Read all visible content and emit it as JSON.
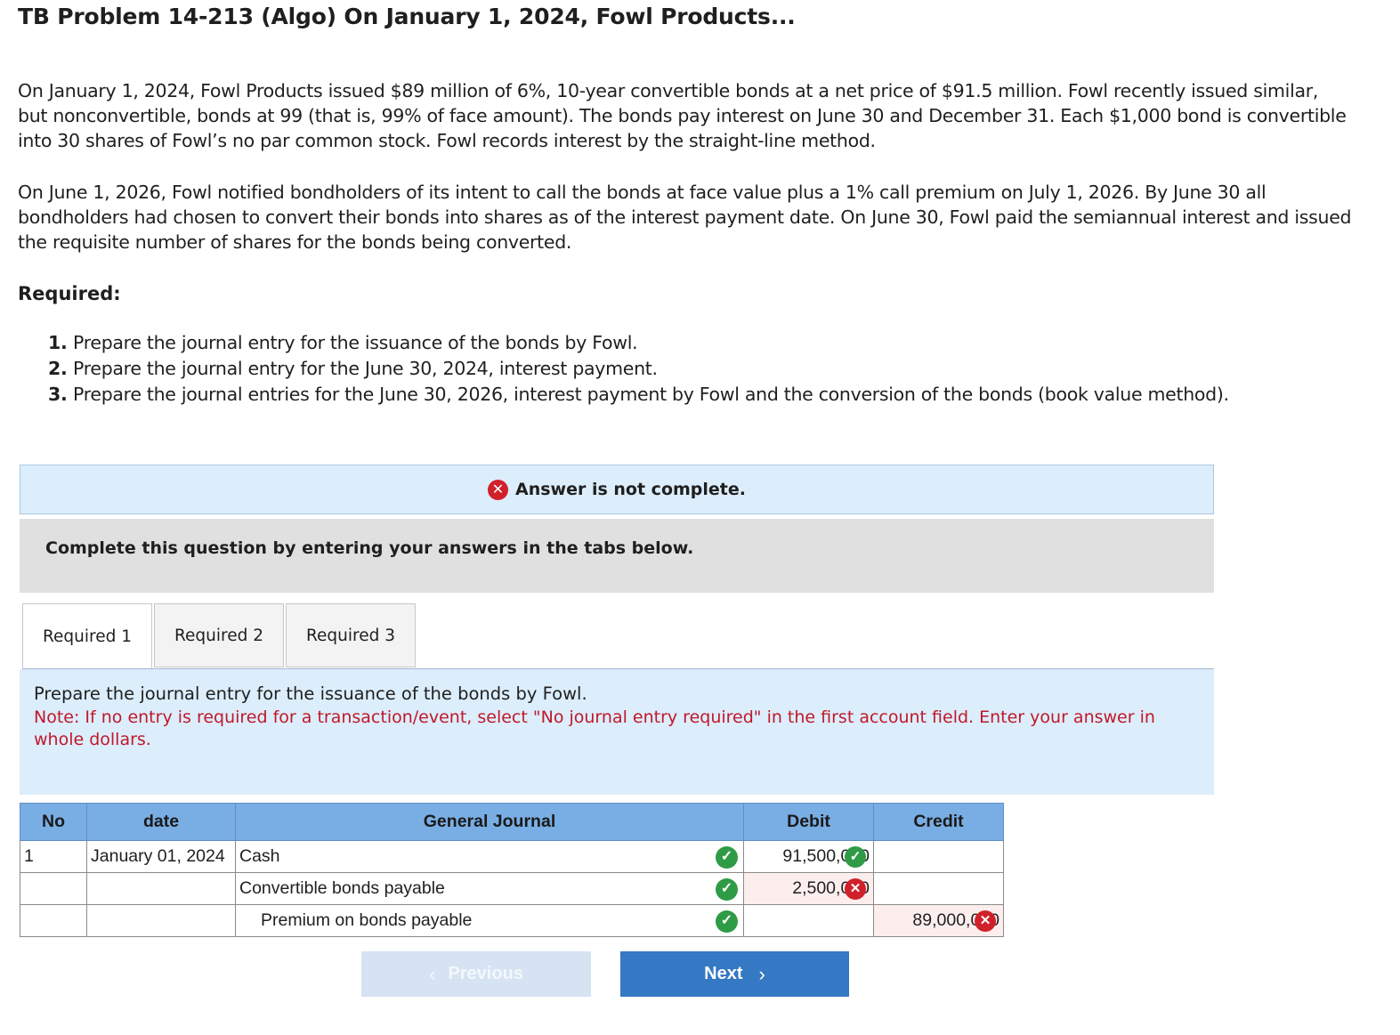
{
  "title": "TB Problem 14-213 (Algo) On January 1, 2024, Fowl Products...",
  "paragraphs": [
    "On January 1, 2024, Fowl Products issued $89 million of 6%, 10-year convertible bonds at a net price of $91.5 million. Fowl recently issued similar, but nonconvertible, bonds at 99 (that is, 99% of face amount). The bonds pay interest on June 30 and December 31. Each $1,000 bond is convertible into 30 shares of Fowl’s no par common stock. Fowl records interest by the straight-line method.",
    "On June 1, 2026, Fowl notified bondholders of its intent to call the bonds at face value plus a 1% call premium on July 1, 2026. By June 30 all bondholders had chosen to convert their bonds into shares as of the interest payment date. On June 30, Fowl paid the semiannual interest and issued the requisite number of shares for the bonds being converted."
  ],
  "required": {
    "heading": "Required:",
    "items": [
      {
        "num": "1.",
        "text": "Prepare the journal entry for the issuance of the bonds by Fowl."
      },
      {
        "num": "2.",
        "text": "Prepare the journal entry for the June 30, 2024, interest payment."
      },
      {
        "num": "3.",
        "text": "Prepare the journal entries for the June 30, 2026, interest payment by Fowl and the conversion of the bonds (book value method)."
      }
    ]
  },
  "status": {
    "text": "Answer is not complete.",
    "icon": "x-circle-icon",
    "color": "#d0212b"
  },
  "instruction": "Complete this question by entering your answers in the tabs below.",
  "tabs": [
    {
      "label": "Required 1",
      "active": true
    },
    {
      "label": "Required 2",
      "active": false
    },
    {
      "label": "Required 3",
      "active": false
    }
  ],
  "prompt": {
    "main": "Prepare the journal entry for the issuance of the bonds by Fowl.",
    "note": "Note: If no entry is required for a transaction/event, select \"No journal entry required\" in the first account field. Enter your answer in whole dollars."
  },
  "journal": {
    "headers": {
      "no": "No",
      "date": "date",
      "account": "General Journal",
      "debit": "Debit",
      "credit": "Credit"
    },
    "rows": [
      {
        "no": "1",
        "date": "January 01, 2024",
        "account": "Cash",
        "account_status": "correct",
        "debit": "91,500,000",
        "debit_status": "correct",
        "credit": "",
        "credit_status": ""
      },
      {
        "no": "",
        "date": "",
        "account": "Convertible bonds payable",
        "account_status": "correct",
        "debit": "2,500,000",
        "debit_status": "incorrect",
        "credit": "",
        "credit_status": ""
      },
      {
        "no": "",
        "date": "",
        "account": "Premium on bonds payable",
        "account_status": "correct",
        "debit": "",
        "debit_status": "",
        "credit": "89,000,000",
        "credit_status": "incorrect"
      }
    ]
  },
  "nav": {
    "previous": "Previous",
    "next": "Next"
  },
  "colors": {
    "accent": "#3578c3",
    "header_blue": "#79aee4",
    "correct": "#2f9b47",
    "incorrect": "#d0212b",
    "note_red": "#c0182a"
  }
}
